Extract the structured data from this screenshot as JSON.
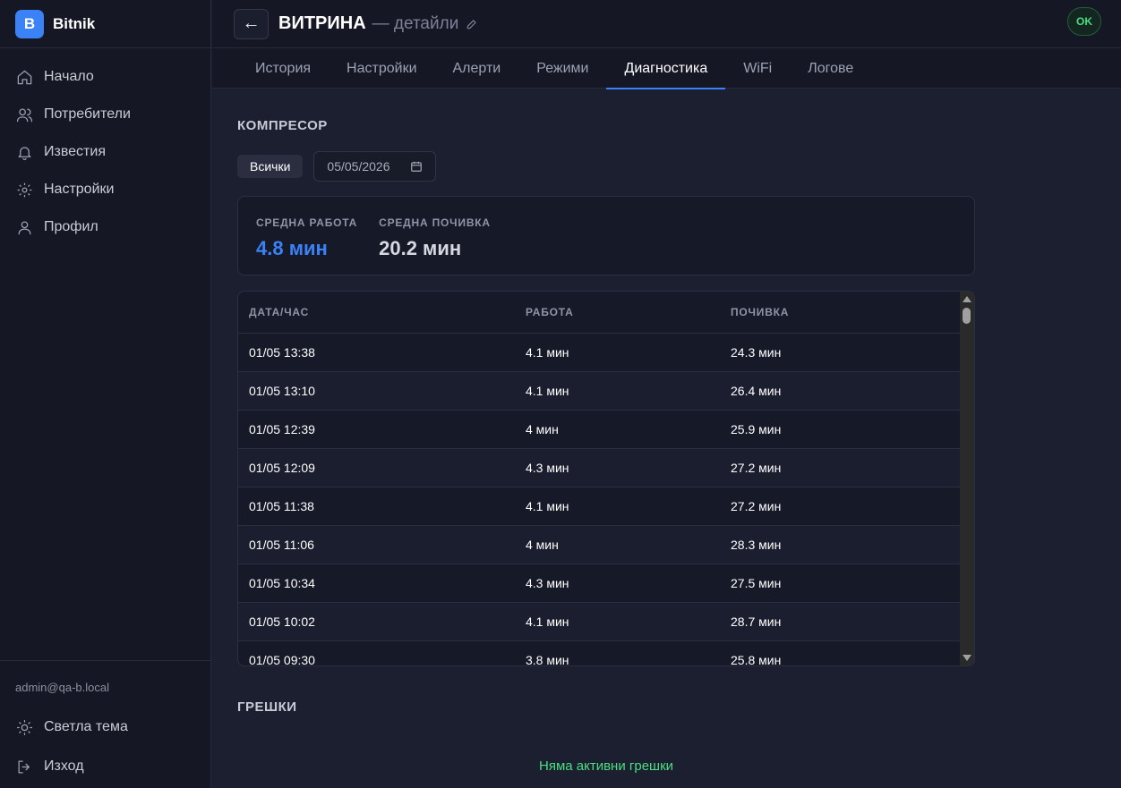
{
  "app": {
    "logo_letter": "B",
    "name": "Bitnik"
  },
  "sidebar": {
    "items": [
      {
        "label": "Начало",
        "icon": "home-icon"
      },
      {
        "label": "Потребители",
        "icon": "users-icon"
      },
      {
        "label": "Известия",
        "icon": "bell-icon"
      },
      {
        "label": "Настройки",
        "icon": "gear-icon"
      },
      {
        "label": "Профил",
        "icon": "user-icon"
      }
    ],
    "user_email": "admin@qa-b.local",
    "theme_label": "Светла тема",
    "logout_label": "Изход"
  },
  "header": {
    "back_symbol": "←",
    "title": "ВИТРИНА",
    "suffix": "— детайли",
    "status": "OK"
  },
  "tabs": [
    {
      "label": "История",
      "active": false
    },
    {
      "label": "Настройки",
      "active": false
    },
    {
      "label": "Алерти",
      "active": false
    },
    {
      "label": "Режими",
      "active": false
    },
    {
      "label": "Диагностика",
      "active": true
    },
    {
      "label": "WiFi",
      "active": false
    },
    {
      "label": "Логове",
      "active": false
    }
  ],
  "compressor": {
    "title": "КОМПРЕСОР",
    "filter_chip": "Всички",
    "date_value": "05/05/2026",
    "stats": {
      "avg_work_label": "СРЕДНА РАБОТА",
      "avg_work_value": "4.8 мин",
      "avg_rest_label": "СРЕДНА ПОЧИВКА",
      "avg_rest_value": "20.2 мин"
    },
    "table": {
      "headers": [
        "ДАТА/ЧАС",
        "РАБОТА",
        "ПОЧИВКА"
      ],
      "rows": [
        [
          "01/05 13:38",
          "4.1 мин",
          "24.3 мин"
        ],
        [
          "01/05 13:10",
          "4.1 мин",
          "26.4 мин"
        ],
        [
          "01/05 12:39",
          "4 мин",
          "25.9 мин"
        ],
        [
          "01/05 12:09",
          "4.3 мин",
          "27.2 мин"
        ],
        [
          "01/05 11:38",
          "4.1 мин",
          "27.2 мин"
        ],
        [
          "01/05 11:06",
          "4 мин",
          "28.3 мин"
        ],
        [
          "01/05 10:34",
          "4.3 мин",
          "27.5 мин"
        ],
        [
          "01/05 10:02",
          "4.1 мин",
          "28.7 мин"
        ],
        [
          "01/05 09:30",
          "3.8 мин",
          "25.8 мин"
        ]
      ]
    }
  },
  "errors": {
    "title": "ГРЕШКИ",
    "empty_message": "Няма активни грешки"
  },
  "colors": {
    "accent": "#3b82f6",
    "ok": "#4ade80",
    "background": "#1c1f30",
    "sidebar": "#151824"
  }
}
